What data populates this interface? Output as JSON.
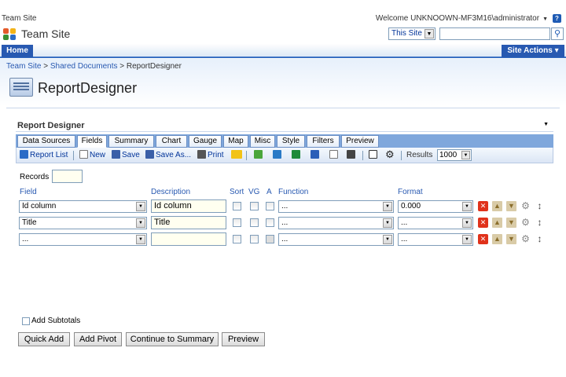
{
  "topbar": {
    "site_crumb": "Team Site",
    "welcome": "Welcome UNKNOOWN-MF3M16\\administrator",
    "help": "?"
  },
  "titlebar": {
    "site_title": "Team Site",
    "scope": "This Site",
    "search_placeholder": ""
  },
  "nav": {
    "home": "Home",
    "site_actions": "Site Actions ▾"
  },
  "breadcrumb": [
    "Team Site",
    "Shared Documents",
    "ReportDesigner"
  ],
  "breadcrumb_sep": " > ",
  "page_title": "ReportDesigner",
  "webpart": {
    "title": "Report Designer",
    "tabs": [
      "Data Sources",
      "Fields",
      "Summary",
      "Chart",
      "Gauge",
      "Map",
      "Misc",
      "Style",
      "Filters",
      "Preview"
    ],
    "active_tab": "Fields",
    "toolbar": {
      "report_list": "Report List",
      "new": "New",
      "save": "Save",
      "save_as": "Save As...",
      "print": "Print",
      "results_label": "Results",
      "results_value": "1000"
    },
    "records_label": "Records",
    "columns": {
      "field": "Field",
      "description": "Description",
      "sort": "Sort",
      "vg": "VG",
      "a": "A",
      "function": "Function",
      "format": "Format"
    },
    "rows": [
      {
        "field": "Id column",
        "description": "Id column",
        "function": "...",
        "format": "0.000"
      },
      {
        "field": "Title",
        "description": "Title",
        "function": "...",
        "format": "..."
      },
      {
        "field": "...",
        "description": "",
        "function": "...",
        "format": "..."
      }
    ],
    "add_subtotals": "Add Subtotals",
    "buttons": {
      "quick_add": "Quick Add",
      "add_pivot": "Add Pivot",
      "continue": "Continue to Summary",
      "preview": "Preview"
    }
  },
  "colors": {
    "accent": "#2859b1",
    "tabstrip": "#7fa7dc",
    "delete": "#e0321b"
  }
}
